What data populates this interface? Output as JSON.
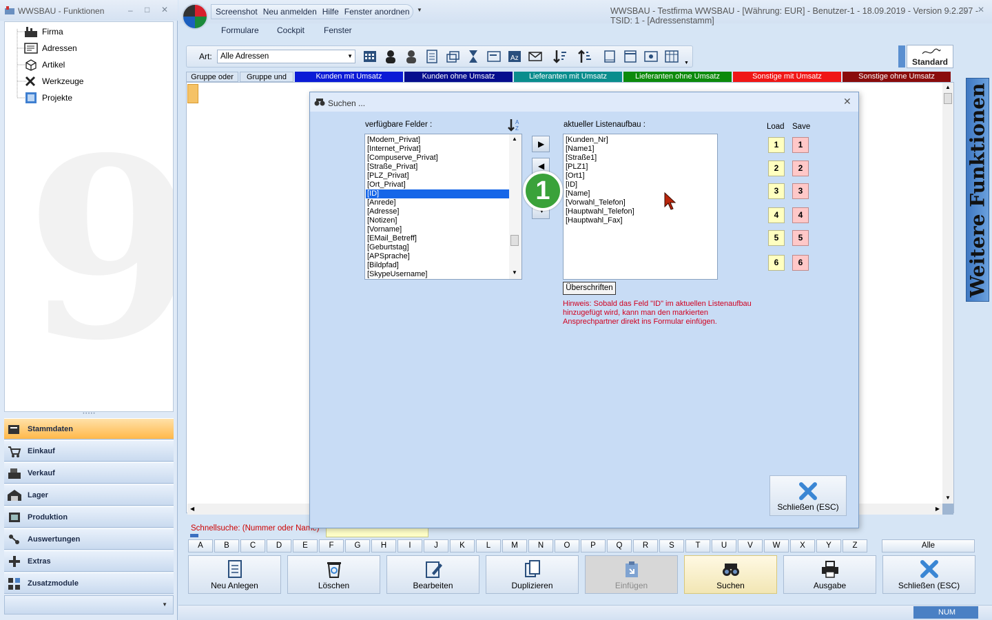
{
  "left_window": {
    "title": "WWSBAU - Funktionen",
    "controls": [
      "–",
      "□",
      "✕"
    ],
    "tree": [
      {
        "label": "Firma",
        "icon": "factory-icon"
      },
      {
        "label": "Adressen",
        "icon": "address-card-icon"
      },
      {
        "label": "Artikel",
        "icon": "box-icon"
      },
      {
        "label": "Werkzeuge",
        "icon": "tools-icon"
      },
      {
        "label": "Projekte",
        "icon": "project-icon"
      }
    ],
    "nav": [
      {
        "label": "Stammdaten",
        "icon": "master-data-icon",
        "active": true
      },
      {
        "label": "Einkauf",
        "icon": "cart-icon"
      },
      {
        "label": "Verkauf",
        "icon": "register-icon"
      },
      {
        "label": "Lager",
        "icon": "warehouse-icon"
      },
      {
        "label": "Produktion",
        "icon": "production-icon"
      },
      {
        "label": "Auswertungen",
        "icon": "analytics-icon"
      },
      {
        "label": "Extras",
        "icon": "extras-icon"
      },
      {
        "label": "Zusatzmodule",
        "icon": "modules-icon"
      }
    ]
  },
  "main_window": {
    "title": "WWSBAU - Testfirma WWSBAU - [Währung: EUR] - Benutzer-1 - 18.09.2019 - Version 9.2.297 - TSID: 1  - [Adressenstamm]",
    "quick_access": [
      "Screenshot",
      "Neu anmelden",
      "Hilfe",
      "Fenster anordnen"
    ],
    "menu": [
      "Formulare",
      "Cockpit",
      "Fenster"
    ],
    "art_label": "Art:",
    "art_value": "Alle Adressen",
    "standard_label": "Standard",
    "side_tab": "Weitere Funktionen",
    "filters": [
      {
        "label": "Gruppe oder",
        "bg": "#d9e5f3",
        "fg": "#000"
      },
      {
        "label": "Gruppe und",
        "bg": "#d9e5f3",
        "fg": "#000"
      },
      {
        "label": "Kunden mit Umsatz",
        "bg": "#0b1bd6",
        "fg": "#fff"
      },
      {
        "label": "Kunden ohne Umsatz",
        "bg": "#060e8e",
        "fg": "#fff"
      },
      {
        "label": "Lieferanten mit Umsatz",
        "bg": "#0a8d8d",
        "fg": "#fff"
      },
      {
        "label": "Lieferanten ohne Umsatz",
        "bg": "#0c8a0c",
        "fg": "#fff"
      },
      {
        "label": "Sonstige mit Umsatz",
        "bg": "#f01616",
        "fg": "#fff"
      },
      {
        "label": "Sonstige ohne Umsatz",
        "bg": "#8a0c0c",
        "fg": "#fff"
      }
    ],
    "quicksearch_label": "Schnellsuche: (Nummer oder Name)",
    "alphabet": [
      "A",
      "B",
      "C",
      "D",
      "E",
      "F",
      "G",
      "H",
      "I",
      "J",
      "K",
      "L",
      "M",
      "N",
      "O",
      "P",
      "Q",
      "R",
      "S",
      "T",
      "U",
      "V",
      "W",
      "X",
      "Y",
      "Z"
    ],
    "alle_label": "Alle",
    "actions": [
      {
        "label": "Neu Anlegen",
        "icon": "new-document-icon"
      },
      {
        "label": "Löschen",
        "icon": "trash-icon"
      },
      {
        "label": "Bearbeiten",
        "icon": "edit-icon"
      },
      {
        "label": "Duplizieren",
        "icon": "duplicate-icon"
      },
      {
        "label": "Einfügen",
        "icon": "paste-icon",
        "disabled": true
      },
      {
        "label": "Suchen",
        "icon": "binoculars-icon",
        "hover": true
      },
      {
        "label": "Ausgabe",
        "icon": "printer-icon"
      },
      {
        "label": "Schließen (ESC)",
        "icon": "close-x-icon"
      }
    ],
    "status_num": "NUM"
  },
  "dialog": {
    "title": "Suchen ...",
    "available_label": "verfügbare Felder :",
    "available_fields": [
      "[Modem_Privat]",
      "[Internet_Privat]",
      "[Compuserve_Privat]",
      "[Straße_Privat]",
      "[PLZ_Privat]",
      "[Ort_Privat]",
      "[ID]",
      "[Anrede]",
      "[Adresse]",
      "[Notizen]",
      "[Vorname]",
      "[EMail_Betreff]",
      "[Geburtstag]",
      "[APSprache]",
      "[Bildpfad]",
      "[SkypeUsername]"
    ],
    "selected_index": 6,
    "current_label": "aktueller Listenaufbau :",
    "current_fields": [
      "[Kunden_Nr]",
      "[Name1]",
      "[Straße1]",
      "[PLZ1]",
      "[Ort1]",
      "[ID]",
      "[Name]",
      "[Vorwahl_Telefon]",
      "[Hauptwahl_Telefon]",
      "[Hauptwahl_Fax]"
    ],
    "headings_button": "Überschriften",
    "hint": "Hinweis: Sobald das Feld \"ID\" im aktuellen Listenaufbau hinzugefügt wird, kann man den markierten Ansprechpartner direkt ins Formular einfügen.",
    "load_label": "Load",
    "save_label": "Save",
    "slots": [
      "1",
      "2",
      "3",
      "4",
      "5",
      "6"
    ],
    "close_button": "Schließen (ESC)",
    "step_badge": "1"
  }
}
